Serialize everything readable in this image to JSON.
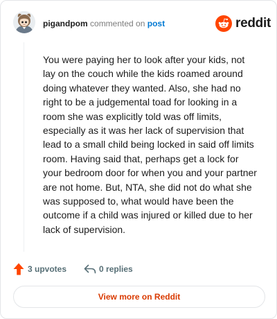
{
  "comment": {
    "username": "pigandpom",
    "action_text": "commented on",
    "post_link": "post",
    "body": "You were paying her to look after your kids, not lay on the couch while the kids roamed around doing whatever they wanted. Also, she had no right to be a judgemental toad for looking in a room she was explicitly told was off limits, especially as it was her lack of supervision that lead to a small child being locked in said off limits room. Having said that, perhaps get a lock for your bedroom door for when you and your partner are not home. But, NTA, she did not do what she was supposed to, what would have been the outcome if a child was injured or killed due to her lack of supervision."
  },
  "brand": {
    "wordmark": "reddit",
    "icon": "reddit-snoo-icon",
    "color": "#ff4500"
  },
  "stats": {
    "upvotes_label": "3 upvotes",
    "replies_label": "0 replies",
    "upvote_icon": "upvote-arrow-icon",
    "reply_icon": "reply-arrow-icon",
    "upvote_color": "#ff4500"
  },
  "footer": {
    "view_more_label": "View more on Reddit",
    "accent": "#d93a00"
  },
  "avatar": {
    "icon": "user-avatar-icon"
  }
}
